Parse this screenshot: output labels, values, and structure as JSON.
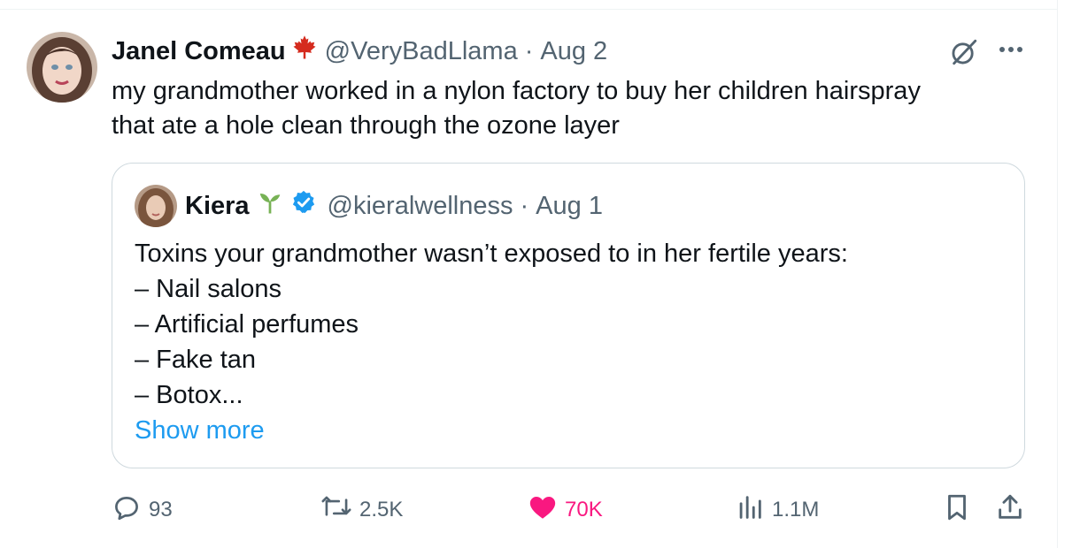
{
  "tweet": {
    "author": {
      "display_name": "Janel Comeau",
      "handle": "@VeryBadLlama",
      "badge_icon": "maple-leaf-icon"
    },
    "separator": "·",
    "date": "Aug 2",
    "text_lines": [
      "my grandmother worked in a nylon factory to buy her children hairspray",
      "that ate a hole clean through the ozone layer"
    ]
  },
  "quote": {
    "author": {
      "display_name": "Kiera",
      "handle": "@kieralwellness",
      "badge_icon": "sprout-icon",
      "verified": true
    },
    "separator": "·",
    "date": "Aug 1",
    "lines": [
      "Toxins your grandmother wasn’t exposed to in her fertile years:",
      "– Nail salons",
      "– Artificial perfumes",
      "– Fake tan",
      "– Botox..."
    ],
    "show_more": "Show more"
  },
  "actions": {
    "replies": "93",
    "reposts": "2.5K",
    "likes": "70K",
    "views": "1.1M"
  },
  "colors": {
    "text": "#0f1419",
    "secondary": "#536471",
    "link": "#1d9bf0",
    "like": "#f91880",
    "verified": "#1d9bf0",
    "border": "#cfd9de"
  }
}
